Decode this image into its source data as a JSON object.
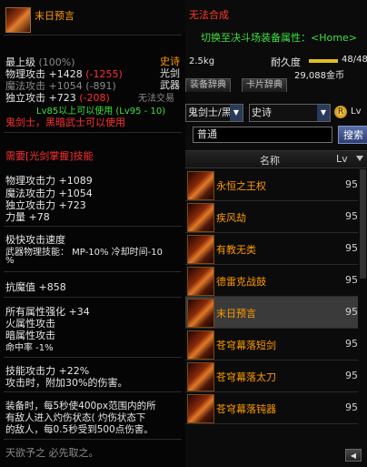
{
  "tooltip": {
    "item_name": "末日预言",
    "rarity": "史诗",
    "weapon_class": "光剑",
    "item_type": "武器",
    "lines": {
      "upgrade": "最上级",
      "upgrade_pct": "(100%)",
      "phys_label": "物理攻击 +1428",
      "phys_diff": "(-1255)",
      "mag_label": "魔法攻击 +1054",
      "mag_diff": "(-891)",
      "ind_label": "独立攻击 +723",
      "ind_diff": "(-208)",
      "trade": "无法交易",
      "level_req": "Lv85以上可以使用 (Lv95 - 10)",
      "class_req": "鬼剑士，黑暗武士可以使用",
      "skill_req": "需要[光剑掌握]技能",
      "stat1": "物理攻击力 +1089",
      "stat2": "魔法攻击力 +1054",
      "stat3": "独立攻击力 +723",
      "stat4": "力量 +78",
      "speed": "极快攻击速度",
      "weapon_skill": "武器物理技能： MP-10% 冷却时间-10",
      "weapon_skill2": "%",
      "anti_devil": "抗魔值 +858",
      "elem1": "所有属性强化 +34",
      "elem2": "火属性攻击",
      "elem3": "暗属性攻击",
      "hit": "命中率 -1%",
      "skill_atk": "技能攻击力 +22%",
      "atk_add": "攻击时，附加30%的伤害。",
      "equip1": "装备时，每5秒使400px范围内的所",
      "equip2": "有敌人进入灼伤状态( 灼伤状态下",
      "equip3": "的敌人，每0.5秒受到500点伤害。",
      "flavor": "天欲予之 必先取之。"
    }
  },
  "shop": {
    "title": "无法合成",
    "switch_label": "切换至决斗场装备属性：<Home>",
    "weight": "2.5kg",
    "durability_label": "耐久度",
    "durability": "48/48",
    "durability_fraction": 1.0,
    "price": "29,088金币",
    "tabs": [
      "装备辞典",
      "卡片辞典"
    ],
    "class_select": "鬼剑士/黑",
    "rarity_select": "史诗",
    "lv_label": "Lv",
    "search_value": "普通",
    "search_button": "搜索",
    "col_name": "名称",
    "col_lv": "Lv",
    "items": [
      {
        "name": "永恒之王权",
        "lv": "95"
      },
      {
        "name": "疾风劫",
        "lv": "95"
      },
      {
        "name": "有教无类",
        "lv": "95"
      },
      {
        "name": "德雷克战鼓",
        "lv": "95"
      },
      {
        "name": "末日预言",
        "lv": "95"
      },
      {
        "name": "苍穹幕落短剑",
        "lv": "95"
      },
      {
        "name": "苍穹幕落太刀",
        "lv": "95"
      },
      {
        "name": "苍穹幕落钝器",
        "lv": "95"
      }
    ]
  },
  "colors": {
    "epic_orange": "#ff9a00",
    "requirement_red": "#ff3030",
    "green_text": "#40e040"
  }
}
